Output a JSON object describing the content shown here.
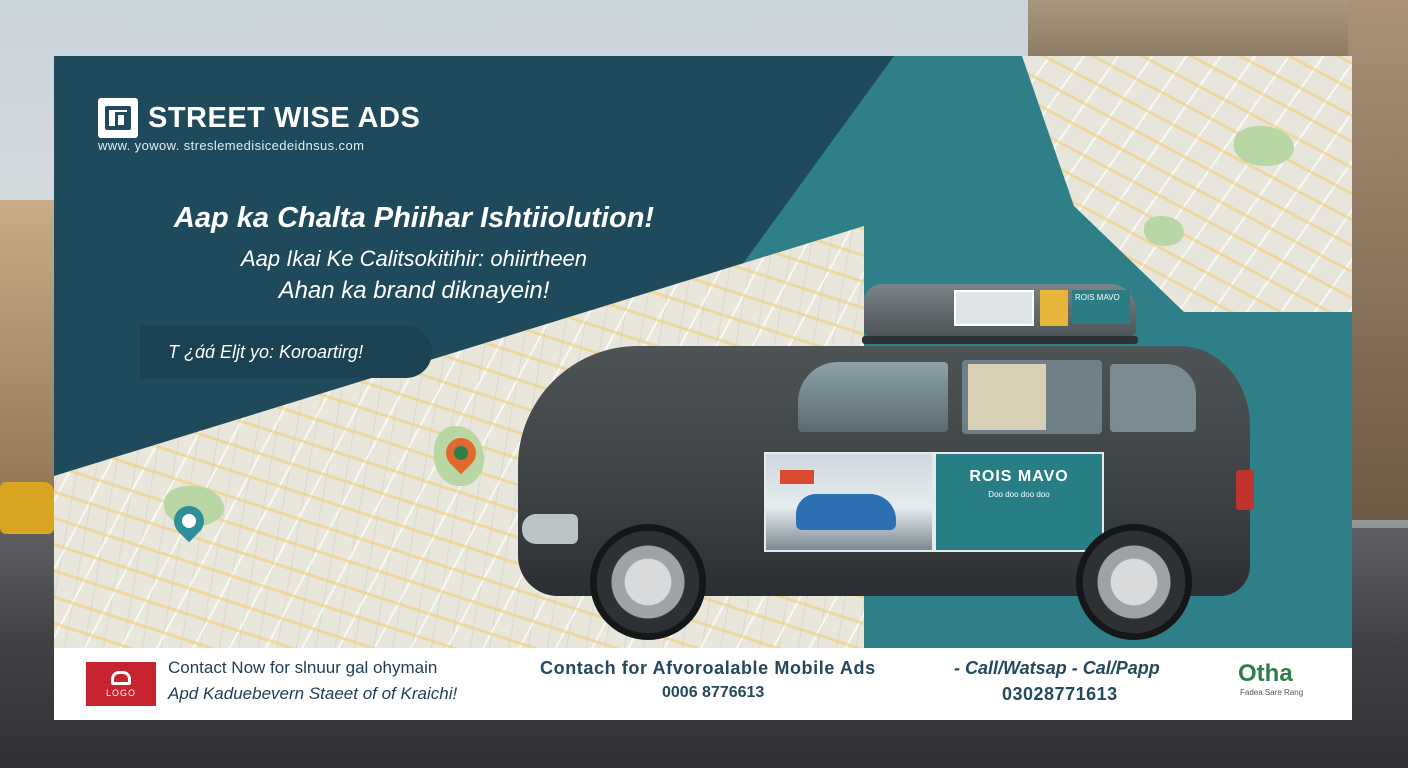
{
  "brand": {
    "name": "STREET WISE ADS",
    "url": "www. yowow. streslemedisicedeidnsus.com",
    "logo_icon": "square-logo-icon"
  },
  "hero": {
    "headline": "Aap ka Chalta Phiihar Ishtiiolution!",
    "subline1": "Aap Ikai Ke Calitsokitihir: ohiirtheen",
    "subline2": "Ahan ka brand diknayein!",
    "cta": "T ¿ɑ́ɑ́ Eljt yo: Koroartirg!"
  },
  "map_pins": [
    "map-pin-orange",
    "map-pin-orange",
    "map-pin-teal"
  ],
  "car_ads": {
    "side_panel_title": "ROIS MAVO",
    "side_panel_sub": "Doo doo doo doo",
    "roof_ad_title": "ROIS MAVO"
  },
  "contact": {
    "left_logo_label": "LOGO",
    "left_line1": "Contact Now for slnuur gal ohymain",
    "left_line2": "Apd Kaduebevern Staeet of of Kraichi!",
    "mid_line1": "Contach  for  Afvoroalable  Mobile Ads",
    "mid_line2": "0006 8776613",
    "right_line1": "- Call/Watsap - Cal/Papp",
    "right_line2": "03028771613",
    "right_logo_text": "Otha",
    "right_logo_sub": "Fadea Sare Rang"
  },
  "colors": {
    "navy": "#1f4a5c",
    "teal": "#2f7f88",
    "red": "#c8242f",
    "green": "#2e7d4b"
  }
}
